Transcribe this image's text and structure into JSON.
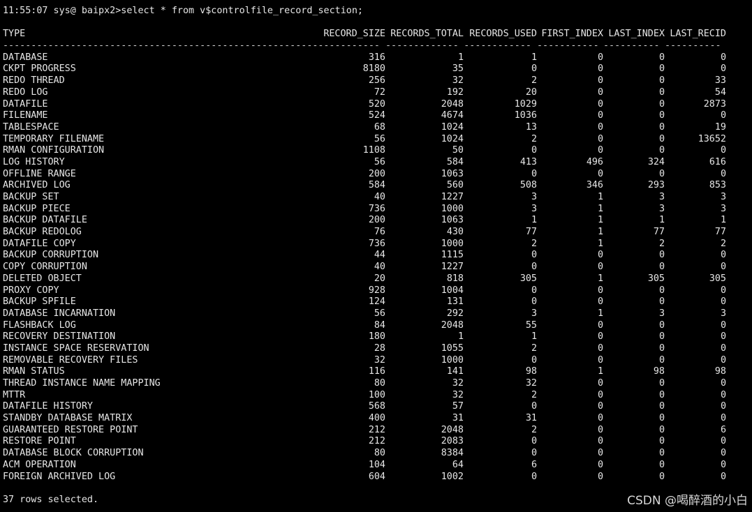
{
  "terminal": {
    "prompt_line": "11:55:07 sys@ baipx2>select * from v$controlfile_record_section;",
    "columns": [
      "TYPE",
      "RECORD_SIZE",
      "RECORDS_TOTAL",
      "RECORDS_USED",
      "FIRST_INDEX",
      "LAST_INDEX",
      "LAST_RECID"
    ],
    "separators": [
      "----------------------------------------------------------",
      "-----------",
      "-------------",
      "------------",
      "-----------",
      "----------",
      "----------"
    ],
    "rows": [
      [
        "DATABASE",
        "316",
        "1",
        "1",
        "0",
        "0",
        "0"
      ],
      [
        "CKPT PROGRESS",
        "8180",
        "35",
        "0",
        "0",
        "0",
        "0"
      ],
      [
        "REDO THREAD",
        "256",
        "32",
        "2",
        "0",
        "0",
        "33"
      ],
      [
        "REDO LOG",
        "72",
        "192",
        "20",
        "0",
        "0",
        "54"
      ],
      [
        "DATAFILE",
        "520",
        "2048",
        "1029",
        "0",
        "0",
        "2873"
      ],
      [
        "FILENAME",
        "524",
        "4674",
        "1036",
        "0",
        "0",
        "0"
      ],
      [
        "TABLESPACE",
        "68",
        "1024",
        "13",
        "0",
        "0",
        "19"
      ],
      [
        "TEMPORARY FILENAME",
        "56",
        "1024",
        "2",
        "0",
        "0",
        "13652"
      ],
      [
        "RMAN CONFIGURATION",
        "1108",
        "50",
        "0",
        "0",
        "0",
        "0"
      ],
      [
        "LOG HISTORY",
        "56",
        "584",
        "413",
        "496",
        "324",
        "616"
      ],
      [
        "OFFLINE RANGE",
        "200",
        "1063",
        "0",
        "0",
        "0",
        "0"
      ],
      [
        "ARCHIVED LOG",
        "584",
        "560",
        "508",
        "346",
        "293",
        "853"
      ],
      [
        "BACKUP SET",
        "40",
        "1227",
        "3",
        "1",
        "3",
        "3"
      ],
      [
        "BACKUP PIECE",
        "736",
        "1000",
        "3",
        "1",
        "3",
        "3"
      ],
      [
        "BACKUP DATAFILE",
        "200",
        "1063",
        "1",
        "1",
        "1",
        "1"
      ],
      [
        "BACKUP REDOLOG",
        "76",
        "430",
        "77",
        "1",
        "77",
        "77"
      ],
      [
        "DATAFILE COPY",
        "736",
        "1000",
        "2",
        "1",
        "2",
        "2"
      ],
      [
        "BACKUP CORRUPTION",
        "44",
        "1115",
        "0",
        "0",
        "0",
        "0"
      ],
      [
        "COPY CORRUPTION",
        "40",
        "1227",
        "0",
        "0",
        "0",
        "0"
      ],
      [
        "DELETED OBJECT",
        "20",
        "818",
        "305",
        "1",
        "305",
        "305"
      ],
      [
        "PROXY COPY",
        "928",
        "1004",
        "0",
        "0",
        "0",
        "0"
      ],
      [
        "BACKUP SPFILE",
        "124",
        "131",
        "0",
        "0",
        "0",
        "0"
      ],
      [
        "DATABASE INCARNATION",
        "56",
        "292",
        "3",
        "1",
        "3",
        "3"
      ],
      [
        "FLASHBACK LOG",
        "84",
        "2048",
        "55",
        "0",
        "0",
        "0"
      ],
      [
        "RECOVERY DESTINATION",
        "180",
        "1",
        "1",
        "0",
        "0",
        "0"
      ],
      [
        "INSTANCE SPACE RESERVATION",
        "28",
        "1055",
        "2",
        "0",
        "0",
        "0"
      ],
      [
        "REMOVABLE RECOVERY FILES",
        "32",
        "1000",
        "0",
        "0",
        "0",
        "0"
      ],
      [
        "RMAN STATUS",
        "116",
        "141",
        "98",
        "1",
        "98",
        "98"
      ],
      [
        "THREAD INSTANCE NAME MAPPING",
        "80",
        "32",
        "32",
        "0",
        "0",
        "0"
      ],
      [
        "MTTR",
        "100",
        "32",
        "2",
        "0",
        "0",
        "0"
      ],
      [
        "DATAFILE HISTORY",
        "568",
        "57",
        "0",
        "0",
        "0",
        "0"
      ],
      [
        "STANDBY DATABASE MATRIX",
        "400",
        "31",
        "31",
        "0",
        "0",
        "0"
      ],
      [
        "GUARANTEED RESTORE POINT",
        "212",
        "2048",
        "2",
        "0",
        "0",
        "6"
      ],
      [
        "RESTORE POINT",
        "212",
        "2083",
        "0",
        "0",
        "0",
        "0"
      ],
      [
        "DATABASE BLOCK CORRUPTION",
        "80",
        "8384",
        "0",
        "0",
        "0",
        "0"
      ],
      [
        "ACM OPERATION",
        "104",
        "64",
        "6",
        "0",
        "0",
        "0"
      ],
      [
        "FOREIGN ARCHIVED LOG",
        "604",
        "1002",
        "0",
        "0",
        "0",
        "0"
      ]
    ],
    "footer": "37 rows selected."
  },
  "watermark": "CSDN @喝醉酒的小白",
  "colors": {
    "background": "#000000",
    "text": "#e6e6e6"
  }
}
